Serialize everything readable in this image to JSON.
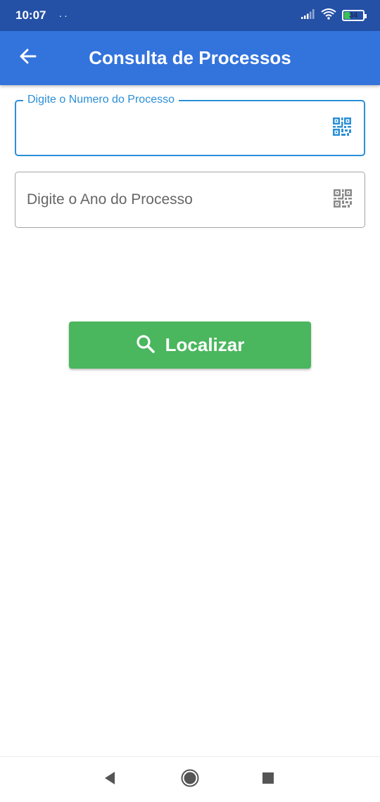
{
  "status_bar": {
    "time": "10:07",
    "dots": "··",
    "battery": "34",
    "battery_level": 0.34,
    "signal_icon": "cellular-signal-icon",
    "wifi_icon": "wifi-icon"
  },
  "app_bar": {
    "title": "Consulta de Processos",
    "back_icon": "arrow-left-icon",
    "color": "#3373dc"
  },
  "form": {
    "numero": {
      "label": "Digite o Numero do Processo",
      "value": "",
      "icon": "qr-code-icon",
      "focused": true,
      "accent": "#2b8fd8"
    },
    "ano": {
      "placeholder": "Digite o Ano do Processo",
      "value": "",
      "icon": "qr-code-icon"
    }
  },
  "search_button": {
    "label": "Localizar",
    "icon": "search-icon",
    "color": "#4ab65e"
  },
  "nav_bar": {
    "back_icon": "triangle-back-icon",
    "home_icon": "circle-home-icon",
    "recents_icon": "square-recents-icon"
  }
}
